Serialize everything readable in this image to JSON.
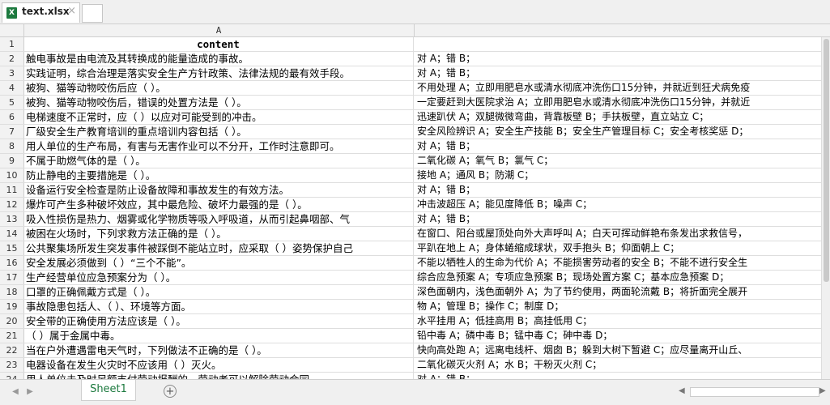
{
  "tabs": {
    "file_name": "text.xlsx",
    "file_icon": "excel-icon",
    "close": "×"
  },
  "sheet": {
    "column_a": "A",
    "rows": [
      {
        "n": "1",
        "a": "content",
        "b": ""
      },
      {
        "n": "2",
        "a": "触电事故是由电流及其转换成的能量造成的事故。",
        "b": "对 A；错 B；"
      },
      {
        "n": "3",
        "a": "实践证明，综合治理是落实安全生产方针政策、法律法规的最有效手段。",
        "b": "对 A；错 B；"
      },
      {
        "n": "4",
        "a": "被狗、猫等动物咬伤后应（ ）。",
        "b": "不用处理 A；立即用肥皂水或清水彻底冲洗伤口15分钟，并就近到狂犬病免疫"
      },
      {
        "n": "5",
        "a": "被狗、猫等动物咬伤后，错误的处置方法是（ ）。",
        "b": "一定要赶到大医院求治 A；立即用肥皂水或清水彻底冲洗伤口15分钟，并就近"
      },
      {
        "n": "6",
        "a": "电梯速度不正常时，应（ ）以应对可能受到的冲击。",
        "b": "迅速趴伏 A；双腿微微弯曲，背靠板壁 B；手扶板壁，直立站立 C；"
      },
      {
        "n": "7",
        "a": "厂级安全生产教育培训的重点培训内容包括（ ）。",
        "b": "安全风险辨识 A；安全生产技能 B；安全生产管理目标 C；安全考核奖惩 D；"
      },
      {
        "n": "8",
        "a": "用人单位的生产布局，有害与无害作业可以不分开，工作时注意即可。",
        "b": "对 A；错 B；"
      },
      {
        "n": "9",
        "a": "不属于助燃气体的是（ ）。",
        "b": "二氧化碳 A；氧气 B；氯气 C；"
      },
      {
        "n": "10",
        "a": "防止静电的主要措施是（ ）。",
        "b": "接地 A；通风 B；防潮 C；"
      },
      {
        "n": "11",
        "a": "设备运行安全检查是防止设备故障和事故发生的有效方法。",
        "b": "对 A；错 B；"
      },
      {
        "n": "12",
        "a": "爆炸可产生多种破坏效应，其中最危险、破坏力最强的是（ ）。",
        "b": "冲击波超压 A；能见度降低 B；噪声 C；"
      },
      {
        "n": "13",
        "a": "吸入性损伤是热力、烟雾或化学物质等吸入呼吸道，从而引起鼻咽部、气",
        "b": "对 A；错 B；"
      },
      {
        "n": "14",
        "a": "被困在火场时，下列求救方法正确的是（ ）。",
        "b": "在窗口、阳台或屋顶处向外大声呼叫 A；白天可挥动鲜艳布条发出求救信号，"
      },
      {
        "n": "15",
        "a": "公共聚集场所发生突发事件被踩倒不能站立时，应采取（ ）姿势保护自己",
        "b": "平趴在地上 A；身体蜷缩成球状，双手抱头 B；仰面朝上 C；"
      },
      {
        "n": "16",
        "a": "安全发展必须做到（ ）“三个不能”。",
        "b": "不能以牺牲人的生命为代价 A；不能损害劳动者的安全 B；不能不进行安全生"
      },
      {
        "n": "17",
        "a": "生产经营单位应急预案分为（ ）。",
        "b": "综合应急预案 A；专项应急预案 B；现场处置方案 C；基本应急预案 D；"
      },
      {
        "n": "18",
        "a": "口罩的正确佩戴方式是（ ）。",
        "b": "深色面朝内，浅色面朝外 A；为了节约使用，两面轮流戴 B；将折面完全展开"
      },
      {
        "n": "19",
        "a": "事故隐患包括人、（ ）、环境等方面。",
        "b": "物 A；管理 B；操作 C；制度 D；"
      },
      {
        "n": "20",
        "a": "安全带的正确使用方法应该是（ ）。",
        "b": "水平挂用 A；低挂高用 B；高挂低用 C；"
      },
      {
        "n": "21",
        "a": "（ ）属于金属中毒。",
        "b": "铅中毒  A；磷中毒 B；锰中毒 C；砷中毒 D；"
      },
      {
        "n": "22",
        "a": "当在户外遭遇雷电天气时，下列做法不正确的是（ ）。",
        "b": "快向高处跑 A；远离电线杆、烟囱 B；躲到大树下暂避 C；应尽量离开山丘、"
      },
      {
        "n": "23",
        "a": "电器设备在发生火灾时不应该用（ ）灭火。",
        "b": "二氧化碳灭火剂 A；水 B；干粉灭火剂 C；"
      },
      {
        "n": "24",
        "a": "用人单位未及时足额支付劳动报酬的，劳动者可以解除劳动合同",
        "b": "对 A；错 B；"
      }
    ]
  },
  "bottom": {
    "sheet_name": "Sheet1",
    "add": "+",
    "nav_prev": "◀",
    "nav_next": "▶"
  }
}
